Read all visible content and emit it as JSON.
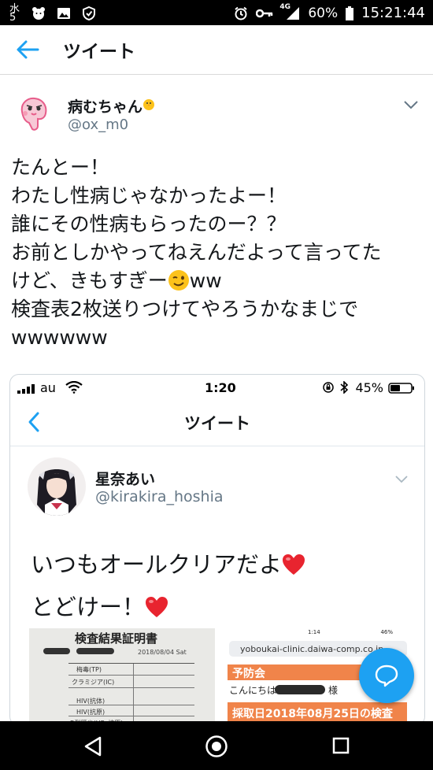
{
  "status_bar": {
    "left_icons": [
      "carrier-logo-icon",
      "face-icon",
      "image-icon",
      "shield-icon"
    ],
    "carrier_glyph": "水5",
    "network": "4G",
    "battery": "60%",
    "time": "15:21:44"
  },
  "header": {
    "title": "ツイート"
  },
  "tweet": {
    "name": "病むちゃん",
    "handle": "@ox_m0",
    "lines": [
      "たんとー！",
      "わたし性病じゃなかったよー！",
      "誰にその性病もらったのー？？",
      "お前としかやってねえんだよって言ってた",
      "けど、きもすぎー",
      "ww",
      "検査表2枚送りつけてやろうかなまじで",
      "wwwwww"
    ]
  },
  "embedded": {
    "carrier": "au",
    "time": "1:20",
    "battery": "45%",
    "title": "ツイート",
    "name": "星奈あい",
    "handle": "@kirakira_hoshia",
    "text1": "いつもオールクリアだよ",
    "text2": "とどけー！",
    "doc_title": "検査結果証明書",
    "doc_date": "2018/08/04 Sat",
    "doc_rows": [
      "梅毒(TP)",
      "クラミジア(IC)",
      "HIV(抗体)",
      "HIV(抗原)",
      "B型肝炎(HBs抗原)"
    ],
    "url": "yoboukai-clinic.daiwa-comp.co.jp",
    "site_name": "予防会",
    "greeting": "こんにちは",
    "greeting_suffix": "様",
    "collection_date": "採取日2018年08月25日の検査",
    "mini_time": "1:14",
    "mini_battery": "46%"
  },
  "colors": {
    "accent": "#1da1f2",
    "orange": "#f0844a",
    "text": "#14171a",
    "muted": "#657786"
  }
}
